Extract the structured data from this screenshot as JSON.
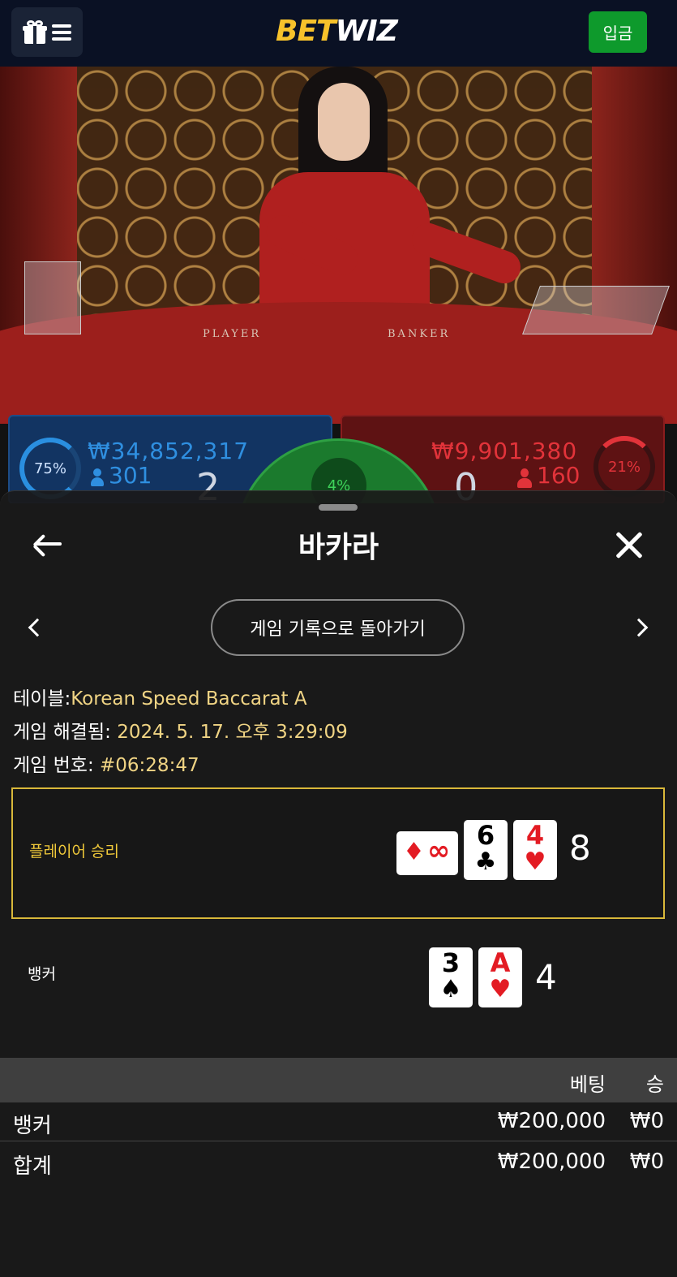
{
  "header": {
    "logo_bet": "BET",
    "logo_wiz": "WIZ",
    "deposit_label": "입금"
  },
  "stream": {
    "player_label": "PLAYER",
    "banker_label": "BANKER",
    "player_amount": "₩34,852,317",
    "player_count": "301",
    "player_pct": "75%",
    "player_score": "2",
    "banker_amount": "₩9,901,380",
    "banker_count": "160",
    "banker_pct": "21%",
    "banker_score": "0",
    "tie_pct": "4%"
  },
  "sheet": {
    "title": "바카라",
    "history_button": "게임 기록으로 돌아가기",
    "table_label": "테이블:",
    "table_value": "Korean Speed Baccarat A",
    "resolved_label": "게임 해결됨:",
    "resolved_value": "2024. 5. 17. 오후 3:29:09",
    "game_no_label": "게임 번호:",
    "game_no_value": "#06:28:47",
    "player_row": {
      "label": "플레이어 승리",
      "score": "8",
      "cards": [
        {
          "rank": "∞",
          "suit": "♦",
          "color": "#e31b23",
          "orientation": "sideways"
        },
        {
          "rank": "6",
          "suit": "♣",
          "color": "#000000"
        },
        {
          "rank": "4",
          "suit": "♥",
          "color": "#e31b23"
        }
      ]
    },
    "banker_row": {
      "label": "뱅커",
      "score": "4",
      "cards": [
        {
          "rank": "3",
          "suit": "♠",
          "color": "#000000"
        },
        {
          "rank": "A",
          "suit": "♥",
          "color": "#e31b23"
        }
      ]
    },
    "bets": {
      "col_bet": "베팅",
      "col_win": "승",
      "rows": [
        {
          "name": "뱅커",
          "bet": "₩200,000",
          "win": "₩0"
        },
        {
          "name": "합계",
          "bet": "₩200,000",
          "win": "₩0"
        }
      ]
    }
  },
  "colors": {
    "topbar": "#0a1124",
    "deposit": "#0e9a2c",
    "logo_accent": "#f7c22b",
    "highlight_border": "#d9b83a",
    "info_value": "#f0d484"
  }
}
